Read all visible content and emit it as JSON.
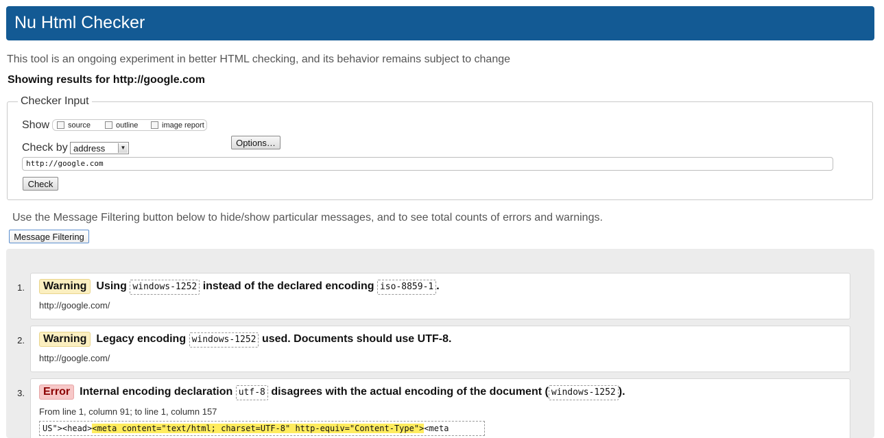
{
  "header": {
    "title": "Nu Html Checker"
  },
  "intro": "This tool is an ongoing experiment in better HTML checking, and its behavior remains subject to change",
  "showing": "Showing results for http://google.com",
  "checker_input": {
    "legend": "Checker Input",
    "show_label": "Show",
    "show_options": [
      "source",
      "outline",
      "image report"
    ],
    "options_button": "Options…",
    "check_by_label": "Check by",
    "check_by_value": "address",
    "url_value": "http://google.com",
    "check_button": "Check"
  },
  "filter_text": "Use the Message Filtering button below to hide/show particular messages, and to see total counts of errors and warnings.",
  "filter_button": "Message Filtering",
  "messages": [
    {
      "num": "1.",
      "type": "Warning",
      "p1": "Using",
      "code1": "windows-1252",
      "p2": "instead of the declared encoding",
      "code2": "iso-8859-1",
      "p3": ".",
      "url": "http://google.com/"
    },
    {
      "num": "2.",
      "type": "Warning",
      "p1": "Legacy encoding",
      "code1": "windows-1252",
      "p2": "used. Documents should use UTF-8.",
      "url": "http://google.com/"
    },
    {
      "num": "3.",
      "type": "Error",
      "p1": "Internal encoding declaration",
      "code1": "utf-8",
      "p2": "disagrees with the actual encoding of the document (",
      "code2": "windows-1252",
      "p3": ").",
      "location": "From line 1, column 91; to line 1, column 157",
      "extract_pre": "US\"><head>",
      "extract_mark": "<meta content=\"text/html; charset=UTF-8\" http-equiv=\"Content-Type\">",
      "extract_post": "<meta"
    }
  ],
  "colors": {
    "header_bg": "#135a94",
    "warning_badge": "#fbefc0",
    "error_badge": "#f7c8c8",
    "highlight": "#ffec5e"
  }
}
